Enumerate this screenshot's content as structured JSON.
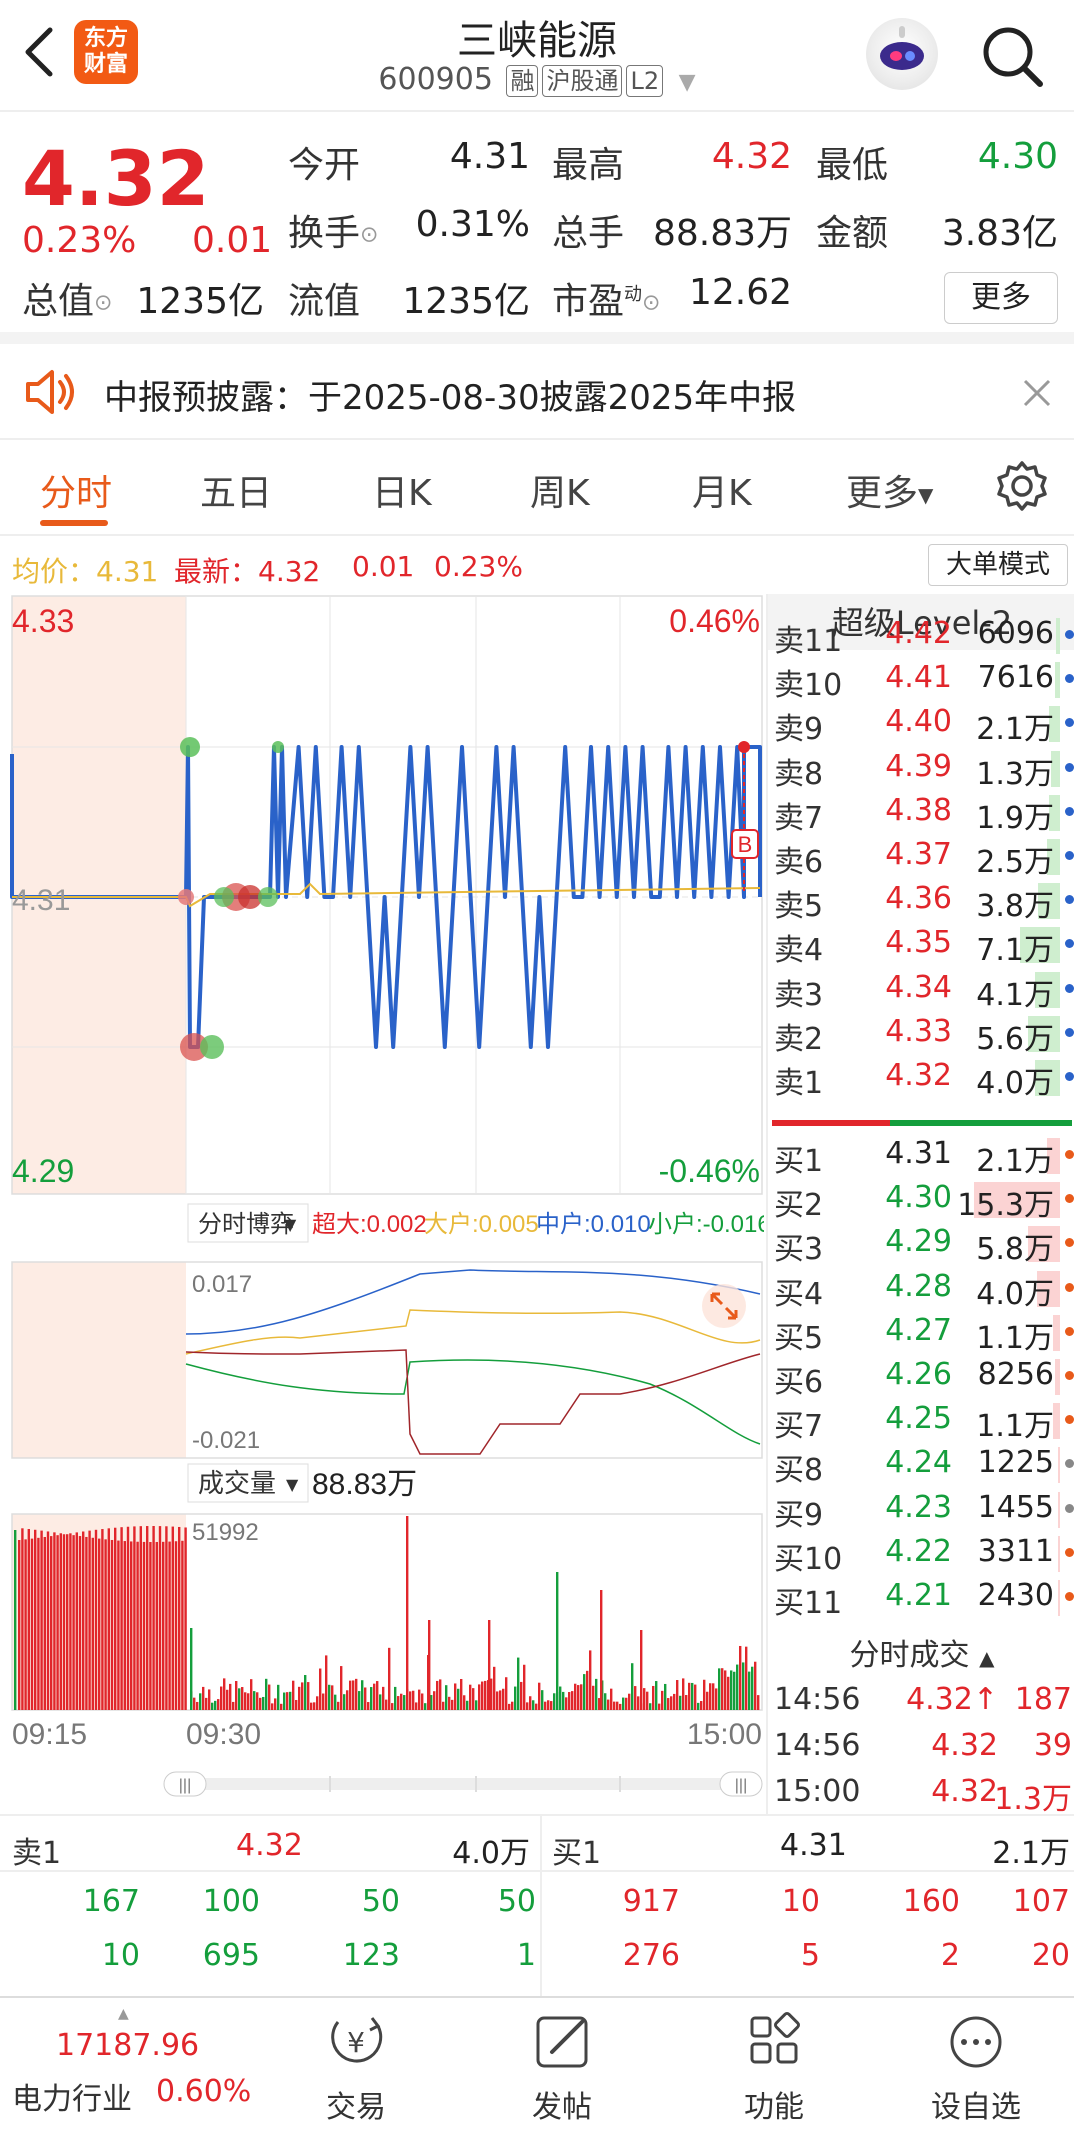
{
  "header": {
    "title": "三峡能源",
    "code": "600905",
    "tags": [
      "融",
      "沪股通",
      "L2"
    ],
    "logo_line1": "东方",
    "logo_line2": "财富"
  },
  "quote": {
    "price": "4.32",
    "pct": "0.23%",
    "chg": "0.01",
    "open_label": "今开",
    "open": "4.31",
    "high_label": "最高",
    "high": "4.32",
    "low_label": "最低",
    "low": "4.30",
    "turnover_label": "换手",
    "turnover": "0.31%",
    "volume_label": "总手",
    "volume": "88.83万",
    "amount_label": "金额",
    "amount": "3.83亿",
    "mktcap_label": "总值",
    "mktcap": "1235亿",
    "float_label": "流值",
    "float": "1235亿",
    "pe_label": "市盈",
    "pe_sup": "动",
    "pe": "12.62",
    "more_label": "更多"
  },
  "notice": {
    "text": "中报预披露：于2025-08-30披露2025年中报"
  },
  "tabs": [
    "分时",
    "五日",
    "日K",
    "周K",
    "月K",
    "更多"
  ],
  "avgline": {
    "avg_label": "均价：",
    "avg": "4.31",
    "latest_label": "最新：",
    "latest": "4.32",
    "chg": "0.01",
    "pct": "0.23%",
    "big_order_label": "大单模式"
  },
  "chart_data": [
    {
      "type": "line",
      "title": "",
      "y_left_max": "4.33",
      "y_left_mid": "4.31",
      "y_left_min": "4.29",
      "y_right_max": "0.46%",
      "y_right_min": "-0.46%",
      "ylim": [
        4.29,
        4.33
      ],
      "series": []
    },
    {
      "type": "line",
      "title": "分时博弈",
      "legend": [
        {
          "name": "超大",
          "value": "0.002",
          "color": "#e1262b"
        },
        {
          "name": "大户",
          "value": "0.005",
          "color": "#e8b93a"
        },
        {
          "name": "中户",
          "value": "0.010",
          "color": "#2a62c9"
        },
        {
          "name": "小户",
          "value": "-0.016",
          "color": "#149e3c"
        }
      ],
      "y_max": "0.017",
      "y_min": "-0.021"
    },
    {
      "type": "bar",
      "title": "成交量",
      "total": "88.83万",
      "y_max": "51992",
      "x_labels": [
        "09:15",
        "09:30",
        "15:00"
      ]
    }
  ],
  "level2": {
    "title": "超级Level-2",
    "asks": [
      {
        "label": "卖11",
        "price": "4.42",
        "vol": "6096",
        "bar": 0.02
      },
      {
        "label": "卖10",
        "price": "4.41",
        "vol": "7616",
        "bar": 0.03
      },
      {
        "label": "卖9",
        "price": "4.40",
        "vol": "2.1万",
        "bar": 0.06
      },
      {
        "label": "卖8",
        "price": "4.39",
        "vol": "1.3万",
        "bar": 0.05
      },
      {
        "label": "卖7",
        "price": "4.38",
        "vol": "1.9万",
        "bar": 0.06
      },
      {
        "label": "卖6",
        "price": "4.37",
        "vol": "2.5万",
        "bar": 0.07
      },
      {
        "label": "卖5",
        "price": "4.36",
        "vol": "3.8万",
        "bar": 0.12
      },
      {
        "label": "卖4",
        "price": "4.35",
        "vol": "7.1万",
        "bar": 0.22
      },
      {
        "label": "卖3",
        "price": "4.34",
        "vol": "4.1万",
        "bar": 0.14
      },
      {
        "label": "卖2",
        "price": "4.33",
        "vol": "5.6万",
        "bar": 0.18
      },
      {
        "label": "卖1",
        "price": "4.32",
        "vol": "4.0万",
        "bar": 0.14
      }
    ],
    "bids": [
      {
        "label": "买1",
        "price": "4.31",
        "vol": "2.1万",
        "bar": 0.07
      },
      {
        "label": "买2",
        "price": "4.30",
        "vol": "15.3万",
        "bar": 0.48
      },
      {
        "label": "买3",
        "price": "4.29",
        "vol": "5.8万",
        "bar": 0.18
      },
      {
        "label": "买4",
        "price": "4.28",
        "vol": "4.0万",
        "bar": 0.13
      },
      {
        "label": "买5",
        "price": "4.27",
        "vol": "1.1万",
        "bar": 0.04
      },
      {
        "label": "买6",
        "price": "4.26",
        "vol": "8256",
        "bar": 0.03
      },
      {
        "label": "买7",
        "price": "4.25",
        "vol": "1.1万",
        "bar": 0.04
      },
      {
        "label": "买8",
        "price": "4.24",
        "vol": "1225",
        "bar": 0.0
      },
      {
        "label": "买9",
        "price": "4.23",
        "vol": "1455",
        "bar": 0.0
      },
      {
        "label": "买10",
        "price": "4.22",
        "vol": "3311",
        "bar": 0.01
      },
      {
        "label": "买11",
        "price": "4.21",
        "vol": "2430",
        "bar": 0.01
      }
    ]
  },
  "ticks": {
    "title": "分时成交",
    "rows": [
      {
        "time": "14:56",
        "price": "4.32↑",
        "vol": "187"
      },
      {
        "time": "14:56",
        "price": "4.32",
        "vol": "39"
      },
      {
        "time": "15:00",
        "price": "4.32",
        "vol": "1.3万"
      }
    ]
  },
  "bottom_panel": {
    "sell_label": "卖1",
    "sell_price": "4.32",
    "sell_vol": "4.0万",
    "buy_label": "买1",
    "buy_price": "4.31",
    "buy_vol": "2.1万",
    "sell_rows": [
      [
        "167",
        "100",
        "50",
        "50"
      ],
      [
        "10",
        "695",
        "123",
        "1"
      ]
    ],
    "buy_rows": [
      [
        "917",
        "10",
        "160",
        "107"
      ],
      [
        "276",
        "5",
        "2",
        "20"
      ]
    ]
  },
  "nav": {
    "index_value": "17187.96",
    "industry_label": "电力行业",
    "industry_pct": "0.60%",
    "items": [
      "交易",
      "发帖",
      "功能",
      "设自选"
    ]
  },
  "colors": {
    "up": "#e1262b",
    "down": "#149e3c",
    "accent": "#e85a1a",
    "price_line": "#2a62c9",
    "avg_line": "#e8b93a"
  }
}
